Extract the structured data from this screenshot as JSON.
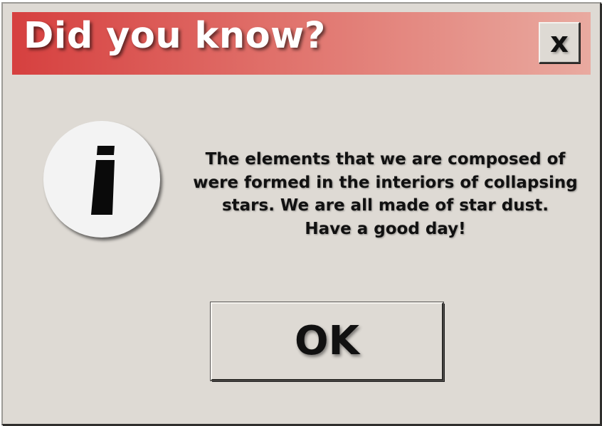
{
  "dialog": {
    "title": "Did you know?",
    "close_label": "x",
    "icon": "info-icon",
    "message_lines": [
      "The elements that we are composed of",
      "were formed in the interiors of collapsing",
      "stars. We are all made of star dust.",
      "Have a good day!"
    ],
    "ok_label": "OK"
  },
  "colors": {
    "titlebar_start": "#d6403f",
    "titlebar_end": "#e9aaa0",
    "dialog_background": "#dedad4",
    "icon_background": "#f3f3f3",
    "text": "#111111"
  }
}
